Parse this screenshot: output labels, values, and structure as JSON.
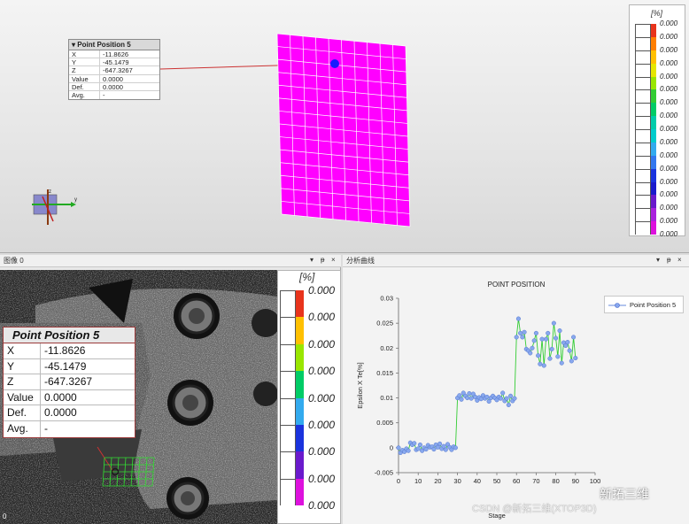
{
  "viewport3d": {
    "tooltip": {
      "title": "Point Position 5",
      "rows": [
        {
          "label": "X",
          "value": "-11.8626"
        },
        {
          "label": "Y",
          "value": "-45.1479"
        },
        {
          "label": "Z",
          "value": "-647.3267"
        },
        {
          "label": "Value",
          "value": "0.0000"
        },
        {
          "label": "Def.",
          "value": "0.0000"
        },
        {
          "label": "Avg.",
          "value": "-"
        }
      ]
    },
    "mesh_color": "#ff00ff",
    "point_color": "#1a1aff",
    "axes": {
      "z": "z",
      "y": "y"
    },
    "colorbar": {
      "unit": "[%]",
      "ticks": [
        "0.000",
        "0.000",
        "0.000",
        "0.000",
        "0.000",
        "0.000",
        "0.000",
        "0.000",
        "0.000",
        "0.000",
        "0.000",
        "0.000",
        "0.000",
        "0.000",
        "0.000",
        "0.000",
        "0.000"
      ],
      "colors": [
        "#ffffff",
        "#ffffff",
        "#ffffff",
        "#ffffff",
        "#ffffff",
        "#ffffff",
        "#ffffff",
        "#ffffff",
        "#ffffff",
        "#ffffff",
        "#ffffff",
        "#ffffff",
        "#ffffff",
        "#ffffff",
        "#ffffff",
        "#ffffff"
      ],
      "gradient": [
        "#e8341c",
        "#ff7f00",
        "#ffc000",
        "#e6e600",
        "#99e600",
        "#33cc33",
        "#00cc66",
        "#00ccaa",
        "#00cccc",
        "#33aaee",
        "#3377ee",
        "#1a33dd",
        "#1a1acc",
        "#6a1acc",
        "#aa22dd",
        "#dd11dd"
      ]
    }
  },
  "left_pane": {
    "title": "图像 0",
    "buttons": [
      "▾",
      "ᵽ",
      "×"
    ],
    "tooltip": {
      "title": "Point Position 5",
      "rows": [
        {
          "label": "X",
          "value": "-11.8626"
        },
        {
          "label": "Y",
          "value": "-45.1479"
        },
        {
          "label": "Z",
          "value": "-647.3267"
        },
        {
          "label": "Value",
          "value": "0.0000"
        },
        {
          "label": "Def.",
          "value": "0.0000"
        },
        {
          "label": "Avg.",
          "value": "-"
        }
      ]
    },
    "colorbar": {
      "unit": "[%]",
      "ticks": [
        "0.000",
        "0.000",
        "0.000",
        "0.000",
        "0.000",
        "0.000",
        "0.000",
        "0.000",
        "0.000"
      ]
    },
    "frame_index": "0"
  },
  "right_pane": {
    "title": "分析曲线",
    "buttons": [
      "▾",
      "ᵽ",
      "×"
    ],
    "watermark": "新拓三维",
    "csdn": "CSDN @新拓三维(XTOP3D)"
  },
  "chart_data": {
    "type": "line",
    "title": "POINT POSITION",
    "xlabel": "Stage",
    "ylabel": "Epsilon X Te[%]",
    "xlim": [
      0,
      100
    ],
    "ylim": [
      -0.005,
      0.03
    ],
    "xticks": [
      "0",
      "10",
      "20",
      "30",
      "40",
      "50",
      "60",
      "70",
      "80",
      "90",
      "100"
    ],
    "yticks": [
      "-0.005",
      "0",
      "0.005",
      "0.01",
      "0.015",
      "0.02",
      "0.025",
      "0.03"
    ],
    "grid": false,
    "legend_position": "top-right",
    "series": [
      {
        "name": "Point Position 5",
        "line_color": "#33cc33",
        "marker_color": "#88a8ee",
        "x": [
          0,
          1,
          2,
          3,
          4,
          5,
          6,
          7,
          8,
          9,
          10,
          11,
          12,
          13,
          14,
          15,
          16,
          17,
          18,
          19,
          20,
          21,
          22,
          23,
          24,
          25,
          26,
          27,
          28,
          29,
          30,
          31,
          32,
          33,
          34,
          35,
          36,
          37,
          38,
          39,
          40,
          41,
          42,
          43,
          44,
          45,
          46,
          47,
          48,
          49,
          50,
          51,
          52,
          53,
          54,
          55,
          56,
          57,
          58,
          59,
          60,
          61,
          62,
          63,
          64,
          65,
          66,
          67,
          68,
          69,
          70,
          71,
          72,
          73,
          74,
          75,
          76,
          77,
          78,
          79,
          80,
          81,
          82,
          83,
          84,
          85,
          86,
          87,
          88,
          89,
          90
        ],
        "y": [
          0.0,
          -0.001,
          -0.0005,
          -0.0008,
          -0.0002,
          -0.0006,
          0.001,
          0.0006,
          0.0009,
          -0.0004,
          -0.0002,
          0.0006,
          -0.0006,
          0.0,
          -0.0003,
          0.0005,
          0.0001,
          0.0002,
          -0.0003,
          0.0006,
          0.0001,
          0.0008,
          -0.0002,
          0.0003,
          -0.0004,
          0.0007,
          0.0001,
          -0.0004,
          0.0002,
          0.0,
          0.01,
          0.0105,
          0.0097,
          0.011,
          0.0104,
          0.01,
          0.0109,
          0.0099,
          0.0108,
          0.0102,
          0.0095,
          0.0101,
          0.0098,
          0.0105,
          0.0099,
          0.0102,
          0.0093,
          0.01,
          0.0104,
          0.01,
          0.0096,
          0.0102,
          0.0099,
          0.011,
          0.0094,
          0.0099,
          0.0086,
          0.0104,
          0.0094,
          0.0099,
          0.0222,
          0.0259,
          0.023,
          0.0222,
          0.0232,
          0.0198,
          0.0195,
          0.019,
          0.02,
          0.0215,
          0.023,
          0.0185,
          0.0168,
          0.0218,
          0.0165,
          0.0218,
          0.023,
          0.0179,
          0.0198,
          0.025,
          0.022,
          0.0183,
          0.0235,
          0.017,
          0.0211,
          0.0205,
          0.0212,
          0.0195,
          0.0174,
          0.0222,
          0.018
        ]
      }
    ]
  }
}
